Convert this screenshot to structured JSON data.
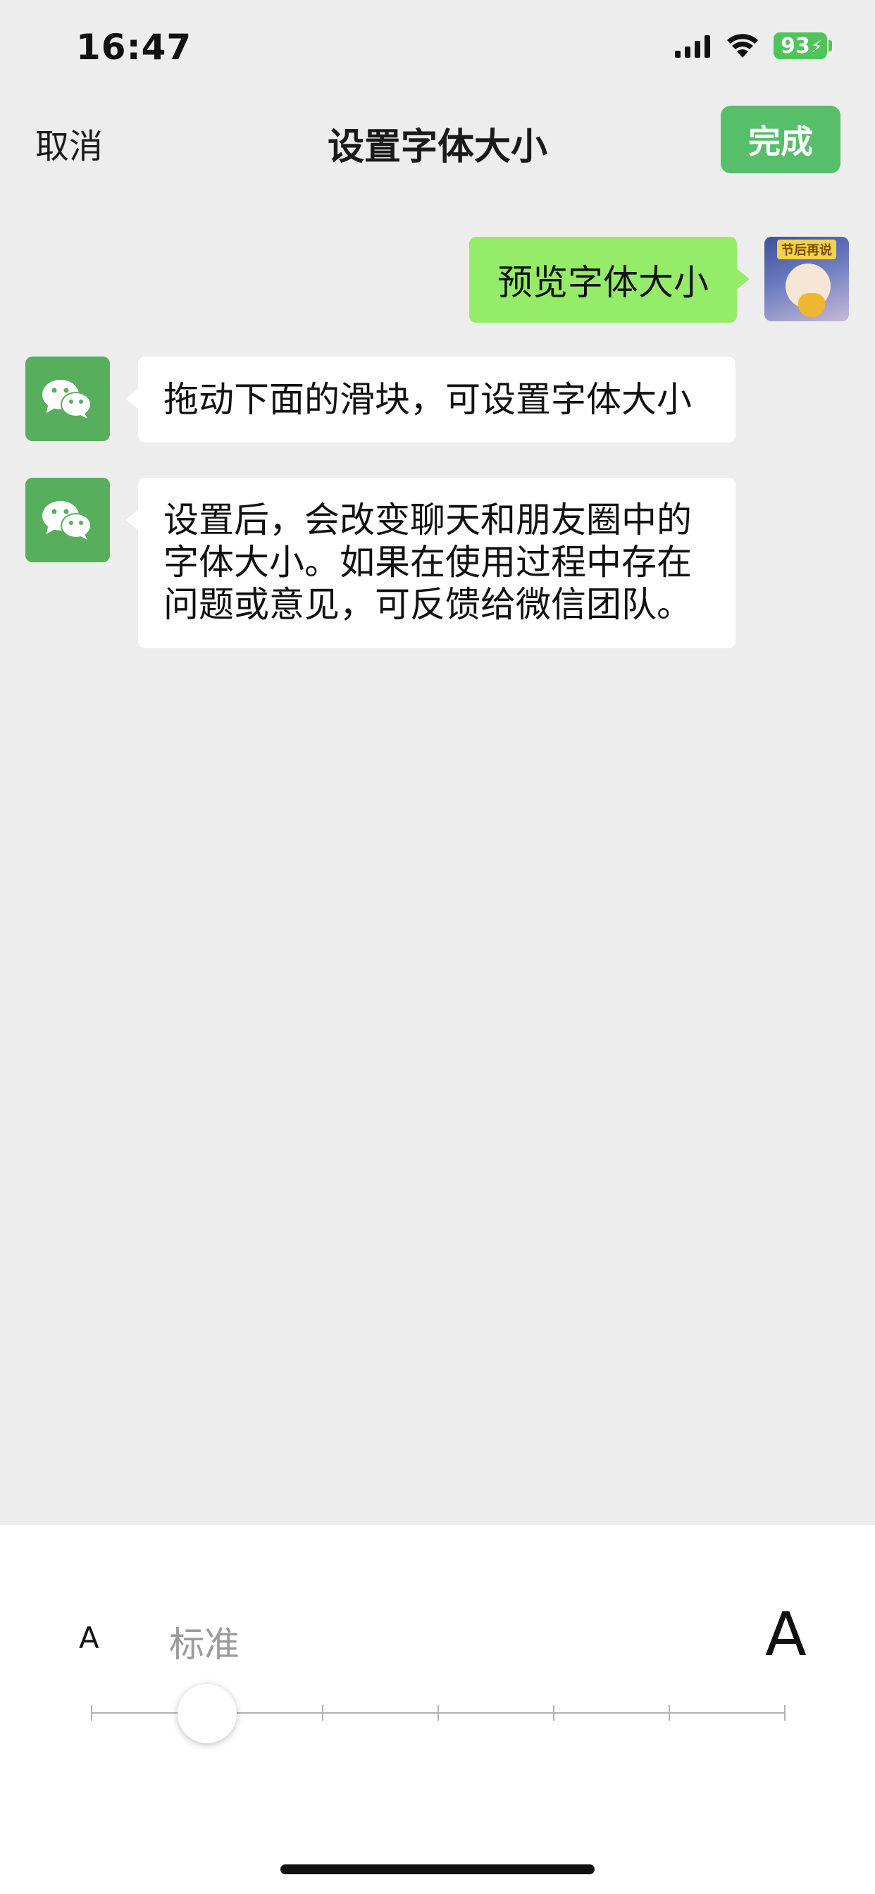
{
  "status_bar": {
    "time": "16:47",
    "battery": "93"
  },
  "nav": {
    "cancel": "取消",
    "title": "设置字体大小",
    "done": "完成"
  },
  "chat": {
    "outgoing": "预览字体大小",
    "incoming": [
      {
        "lines": [
          "拖动下面的滑块，可设置字体大小"
        ]
      },
      {
        "lines": [
          "设置后，会改变聊天和朋友圈中的",
          "字体大小。如果在使用过程中存在",
          "问题或意见，可反馈给微信团队。"
        ]
      }
    ]
  },
  "font_size": {
    "small_label": "A",
    "current_label": "标准",
    "large_label": "A",
    "levels": 7,
    "selected_index": 1
  },
  "colors": {
    "accent": "#57be6a",
    "bubble_out": "#95ec69",
    "background": "#ededed"
  },
  "icons": {
    "user_avatar_banner": "节后再说"
  }
}
